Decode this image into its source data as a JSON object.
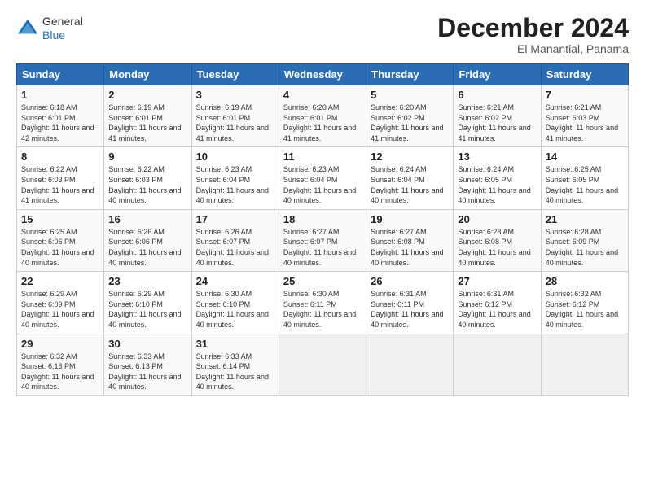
{
  "header": {
    "logo_general": "General",
    "logo_blue": "Blue",
    "month_title": "December 2024",
    "location": "El Manantial, Panama"
  },
  "days_of_week": [
    "Sunday",
    "Monday",
    "Tuesday",
    "Wednesday",
    "Thursday",
    "Friday",
    "Saturday"
  ],
  "weeks": [
    [
      {
        "day": "1",
        "sunrise": "Sunrise: 6:18 AM",
        "sunset": "Sunset: 6:01 PM",
        "daylight": "Daylight: 11 hours and 42 minutes."
      },
      {
        "day": "2",
        "sunrise": "Sunrise: 6:19 AM",
        "sunset": "Sunset: 6:01 PM",
        "daylight": "Daylight: 11 hours and 41 minutes."
      },
      {
        "day": "3",
        "sunrise": "Sunrise: 6:19 AM",
        "sunset": "Sunset: 6:01 PM",
        "daylight": "Daylight: 11 hours and 41 minutes."
      },
      {
        "day": "4",
        "sunrise": "Sunrise: 6:20 AM",
        "sunset": "Sunset: 6:01 PM",
        "daylight": "Daylight: 11 hours and 41 minutes."
      },
      {
        "day": "5",
        "sunrise": "Sunrise: 6:20 AM",
        "sunset": "Sunset: 6:02 PM",
        "daylight": "Daylight: 11 hours and 41 minutes."
      },
      {
        "day": "6",
        "sunrise": "Sunrise: 6:21 AM",
        "sunset": "Sunset: 6:02 PM",
        "daylight": "Daylight: 11 hours and 41 minutes."
      },
      {
        "day": "7",
        "sunrise": "Sunrise: 6:21 AM",
        "sunset": "Sunset: 6:03 PM",
        "daylight": "Daylight: 11 hours and 41 minutes."
      }
    ],
    [
      {
        "day": "8",
        "sunrise": "Sunrise: 6:22 AM",
        "sunset": "Sunset: 6:03 PM",
        "daylight": "Daylight: 11 hours and 41 minutes."
      },
      {
        "day": "9",
        "sunrise": "Sunrise: 6:22 AM",
        "sunset": "Sunset: 6:03 PM",
        "daylight": "Daylight: 11 hours and 40 minutes."
      },
      {
        "day": "10",
        "sunrise": "Sunrise: 6:23 AM",
        "sunset": "Sunset: 6:04 PM",
        "daylight": "Daylight: 11 hours and 40 minutes."
      },
      {
        "day": "11",
        "sunrise": "Sunrise: 6:23 AM",
        "sunset": "Sunset: 6:04 PM",
        "daylight": "Daylight: 11 hours and 40 minutes."
      },
      {
        "day": "12",
        "sunrise": "Sunrise: 6:24 AM",
        "sunset": "Sunset: 6:04 PM",
        "daylight": "Daylight: 11 hours and 40 minutes."
      },
      {
        "day": "13",
        "sunrise": "Sunrise: 6:24 AM",
        "sunset": "Sunset: 6:05 PM",
        "daylight": "Daylight: 11 hours and 40 minutes."
      },
      {
        "day": "14",
        "sunrise": "Sunrise: 6:25 AM",
        "sunset": "Sunset: 6:05 PM",
        "daylight": "Daylight: 11 hours and 40 minutes."
      }
    ],
    [
      {
        "day": "15",
        "sunrise": "Sunrise: 6:25 AM",
        "sunset": "Sunset: 6:06 PM",
        "daylight": "Daylight: 11 hours and 40 minutes."
      },
      {
        "day": "16",
        "sunrise": "Sunrise: 6:26 AM",
        "sunset": "Sunset: 6:06 PM",
        "daylight": "Daylight: 11 hours and 40 minutes."
      },
      {
        "day": "17",
        "sunrise": "Sunrise: 6:26 AM",
        "sunset": "Sunset: 6:07 PM",
        "daylight": "Daylight: 11 hours and 40 minutes."
      },
      {
        "day": "18",
        "sunrise": "Sunrise: 6:27 AM",
        "sunset": "Sunset: 6:07 PM",
        "daylight": "Daylight: 11 hours and 40 minutes."
      },
      {
        "day": "19",
        "sunrise": "Sunrise: 6:27 AM",
        "sunset": "Sunset: 6:08 PM",
        "daylight": "Daylight: 11 hours and 40 minutes."
      },
      {
        "day": "20",
        "sunrise": "Sunrise: 6:28 AM",
        "sunset": "Sunset: 6:08 PM",
        "daylight": "Daylight: 11 hours and 40 minutes."
      },
      {
        "day": "21",
        "sunrise": "Sunrise: 6:28 AM",
        "sunset": "Sunset: 6:09 PM",
        "daylight": "Daylight: 11 hours and 40 minutes."
      }
    ],
    [
      {
        "day": "22",
        "sunrise": "Sunrise: 6:29 AM",
        "sunset": "Sunset: 6:09 PM",
        "daylight": "Daylight: 11 hours and 40 minutes."
      },
      {
        "day": "23",
        "sunrise": "Sunrise: 6:29 AM",
        "sunset": "Sunset: 6:10 PM",
        "daylight": "Daylight: 11 hours and 40 minutes."
      },
      {
        "day": "24",
        "sunrise": "Sunrise: 6:30 AM",
        "sunset": "Sunset: 6:10 PM",
        "daylight": "Daylight: 11 hours and 40 minutes."
      },
      {
        "day": "25",
        "sunrise": "Sunrise: 6:30 AM",
        "sunset": "Sunset: 6:11 PM",
        "daylight": "Daylight: 11 hours and 40 minutes."
      },
      {
        "day": "26",
        "sunrise": "Sunrise: 6:31 AM",
        "sunset": "Sunset: 6:11 PM",
        "daylight": "Daylight: 11 hours and 40 minutes."
      },
      {
        "day": "27",
        "sunrise": "Sunrise: 6:31 AM",
        "sunset": "Sunset: 6:12 PM",
        "daylight": "Daylight: 11 hours and 40 minutes."
      },
      {
        "day": "28",
        "sunrise": "Sunrise: 6:32 AM",
        "sunset": "Sunset: 6:12 PM",
        "daylight": "Daylight: 11 hours and 40 minutes."
      }
    ],
    [
      {
        "day": "29",
        "sunrise": "Sunrise: 6:32 AM",
        "sunset": "Sunset: 6:13 PM",
        "daylight": "Daylight: 11 hours and 40 minutes."
      },
      {
        "day": "30",
        "sunrise": "Sunrise: 6:33 AM",
        "sunset": "Sunset: 6:13 PM",
        "daylight": "Daylight: 11 hours and 40 minutes."
      },
      {
        "day": "31",
        "sunrise": "Sunrise: 6:33 AM",
        "sunset": "Sunset: 6:14 PM",
        "daylight": "Daylight: 11 hours and 40 minutes."
      },
      null,
      null,
      null,
      null
    ]
  ]
}
